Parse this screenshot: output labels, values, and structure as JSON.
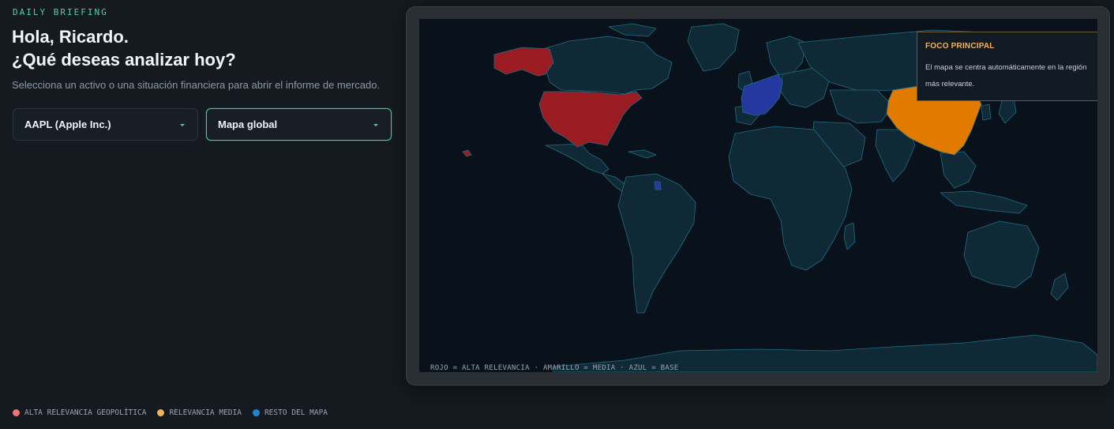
{
  "header": {
    "eyebrow": "DAILY BRIEFING",
    "greeting_line1": "Hola, Ricardo.",
    "greeting_line2": "¿Qué deseas analizar hoy?",
    "subtitle": "Selecciona un activo o una situación financiera para abrir el informe de mercado."
  },
  "selects": {
    "asset": {
      "value": "AAPL (Apple Inc.)",
      "icon": "chevron-down-icon"
    },
    "view": {
      "value": "Mapa global",
      "icon": "chevron-down-icon"
    }
  },
  "map": {
    "caption": "ROJO = ALTA RELEVANCIA · AMARILLO = MEDIA · AZUL = BASE",
    "focus": {
      "title": "FOCO PRINCIPAL",
      "text": "El mapa se centra automáticamente en la región más relevante."
    },
    "colors": {
      "high": "#9b1b22",
      "medium": "#e07b00",
      "base": "#2538a0",
      "land": "#0f2a36",
      "border": "#1e6e86",
      "ocean": "#09111a"
    },
    "highlighted_regions": {
      "high": [
        "United States",
        "Alaska",
        "Hawaii"
      ],
      "medium": [
        "China"
      ],
      "base": [
        "France",
        "Germany",
        "Netherlands",
        "Belgium",
        "Italy",
        "Luxembourg",
        "French Guiana"
      ]
    }
  },
  "legend": {
    "items": [
      {
        "label": "ALTA RELEVANCIA GEOPOLÍTICA",
        "color": "#e8767c"
      },
      {
        "label": "RELEVANCIA MEDIA",
        "color": "#f2b45a"
      },
      {
        "label": "RESTO DEL MAPA",
        "color": "#1f86c9"
      }
    ]
  }
}
